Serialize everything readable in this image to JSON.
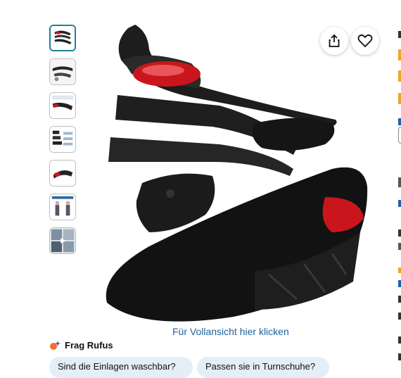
{
  "gallery": {
    "thumbnail_count": 7,
    "selected_index": 0
  },
  "actions": {
    "share_icon": "share-icon",
    "wishlist_icon": "heart-icon"
  },
  "fullview_link": "Für Vollansicht hier klicken",
  "rufus": {
    "label": "Frag Rufus",
    "chips": [
      "Sind die Einlagen waschbar?",
      "Passen sie in Turnschuhe?"
    ]
  },
  "colors": {
    "link": "#2162a1",
    "chip_bg": "#e3eef6",
    "thumb_active_border": "#1d7fa0",
    "insole_black": "#1b1b1b",
    "air_cushion_red": "#c9161c"
  }
}
